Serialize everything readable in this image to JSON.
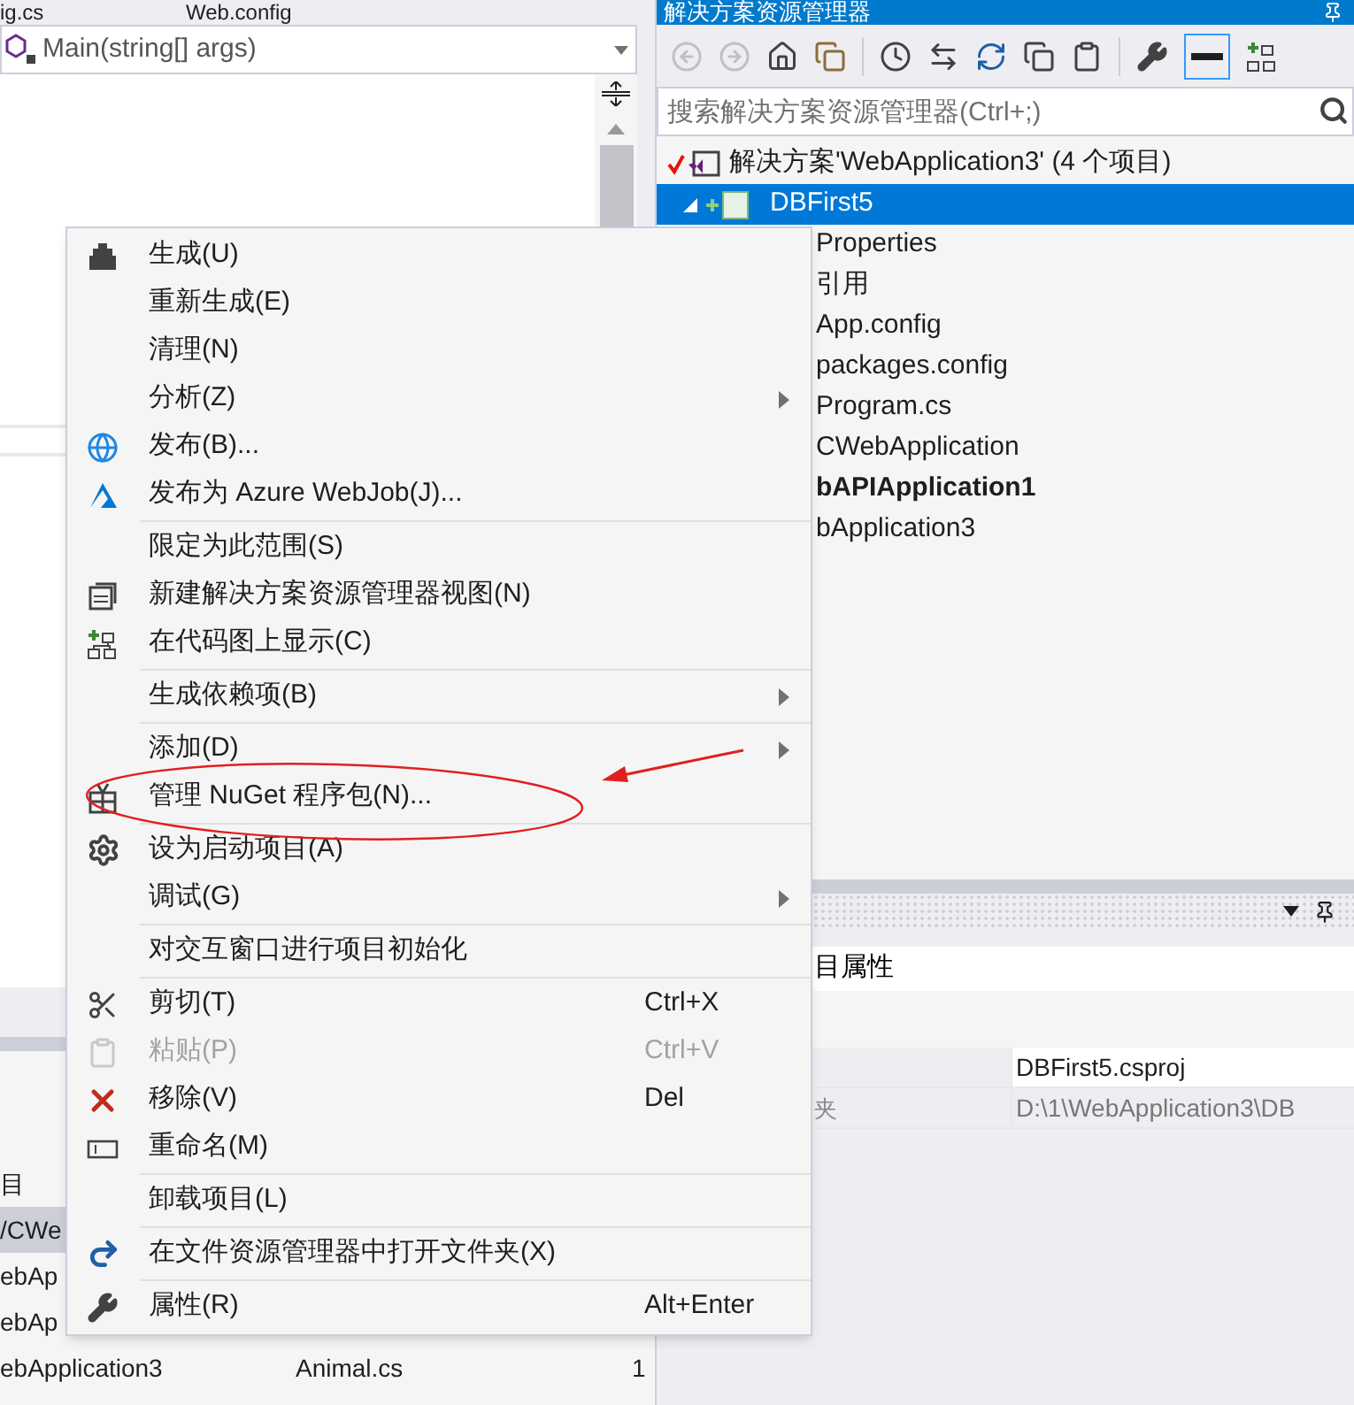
{
  "editor": {
    "tabs": [
      "ig.cs",
      "Web.config"
    ],
    "member_dropdown": "Main(string[] args)"
  },
  "left_list": {
    "header": "目",
    "rows": [
      {
        "cells": [
          "/CWe"
        ],
        "selected": true
      },
      {
        "cells": [
          "ebAp"
        ],
        "selected": false
      },
      {
        "cells": [
          "ebAp"
        ],
        "selected": false
      },
      {
        "cells": [
          "ebApplication3",
          "Animal.cs",
          "1"
        ],
        "selected": false
      }
    ]
  },
  "solution_explorer": {
    "title": "解决方案资源管理器",
    "search": {
      "placeholder": "搜索解决方案资源管理器(Ctrl+;)"
    },
    "tree": [
      {
        "label": "解决方案'WebApplication3' (4 个项目)",
        "selected": false,
        "startup": false,
        "children": [
          {
            "label": "DBFirst5",
            "selected": true,
            "startup": false,
            "expanded": true,
            "children": [
              {
                "label": "Properties",
                "selected": false,
                "startup": false
              },
              {
                "label": "引用",
                "selected": false,
                "startup": false
              },
              {
                "label": "App.config",
                "selected": false,
                "startup": false
              },
              {
                "label": "packages.config",
                "selected": false,
                "startup": false
              },
              {
                "label": "Program.cs",
                "selected": false,
                "startup": false
              }
            ]
          },
          {
            "label": "CWebApplication",
            "selected": false,
            "startup": false
          },
          {
            "label": "bAPIApplication1",
            "selected": false,
            "startup": true
          },
          {
            "label": "bApplication3",
            "selected": false,
            "startup": false
          }
        ]
      }
    ]
  },
  "properties": {
    "header": "目属性",
    "rows": [
      {
        "name": "",
        "value": "DBFirst5.csproj"
      },
      {
        "name": "夹",
        "value": "D:\\1\\WebApplication3\\DB"
      }
    ]
  },
  "context_menu": {
    "groups": [
      [
        {
          "label": "生成(U)",
          "submenu": false,
          "disabled": false
        },
        {
          "label": "重新生成(E)",
          "submenu": false,
          "disabled": false
        },
        {
          "label": "清理(N)",
          "submenu": false,
          "disabled": false
        },
        {
          "label": "分析(Z)",
          "submenu": true,
          "disabled": false
        },
        {
          "label": "发布(B)...",
          "submenu": false,
          "disabled": false
        },
        {
          "label": "发布为 Azure WebJob(J)...",
          "submenu": false,
          "disabled": false
        }
      ],
      [
        {
          "label": "限定为此范围(S)",
          "submenu": false,
          "disabled": false
        },
        {
          "label": "新建解决方案资源管理器视图(N)",
          "submenu": false,
          "disabled": false
        },
        {
          "label": "在代码图上显示(C)",
          "submenu": false,
          "disabled": false
        }
      ],
      [
        {
          "label": "生成依赖项(B)",
          "submenu": true,
          "disabled": false
        }
      ],
      [
        {
          "label": "添加(D)",
          "submenu": true,
          "disabled": false
        },
        {
          "label": "管理 NuGet 程序包(N)...",
          "submenu": false,
          "disabled": false
        }
      ],
      [
        {
          "label": "设为启动项目(A)",
          "submenu": false,
          "disabled": false
        },
        {
          "label": "调试(G)",
          "submenu": true,
          "disabled": false
        }
      ],
      [
        {
          "label": "对交互窗口进行项目初始化",
          "submenu": false,
          "disabled": false
        }
      ],
      [
        {
          "label": "剪切(T)",
          "shortcut": "Ctrl+X",
          "submenu": false,
          "disabled": false
        },
        {
          "label": "粘贴(P)",
          "shortcut": "Ctrl+V",
          "submenu": false,
          "disabled": true
        },
        {
          "label": "移除(V)",
          "shortcut": "Del",
          "submenu": false,
          "disabled": false
        },
        {
          "label": "重命名(M)",
          "submenu": false,
          "disabled": false
        }
      ],
      [
        {
          "label": "卸载项目(L)",
          "submenu": false,
          "disabled": false
        }
      ],
      [
        {
          "label": "在文件资源管理器中打开文件夹(X)",
          "submenu": false,
          "disabled": false
        }
      ],
      [
        {
          "label": "属性(R)",
          "shortcut": "Alt+Enter",
          "submenu": false,
          "disabled": false
        }
      ]
    ]
  }
}
